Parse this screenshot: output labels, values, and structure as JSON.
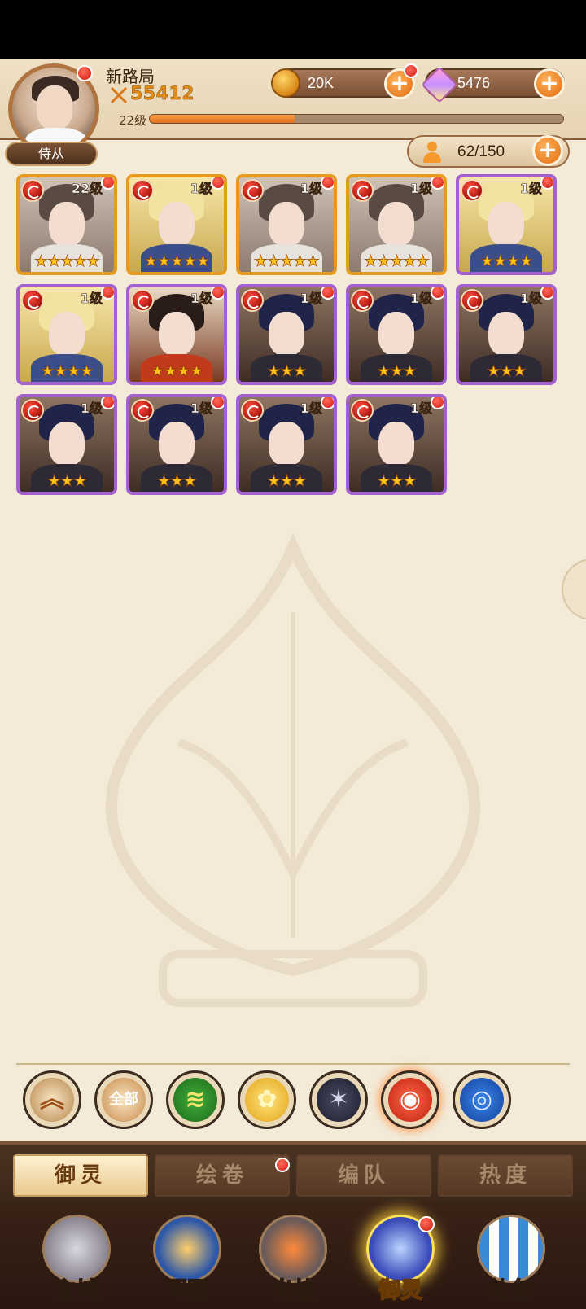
{
  "player": {
    "name": "新路局",
    "power": "55412",
    "level": "22级",
    "xp_fraction": 0.35
  },
  "resources": {
    "gold": "20K",
    "gems": "5476"
  },
  "attendant_tab": "侍从",
  "capacity": "62/150",
  "cards": [
    {
      "level": "22级",
      "frame": "gold",
      "stars": "★★★★★",
      "character": "crowned-lady"
    },
    {
      "level": "1级",
      "frame": "gold",
      "stars": "★★★★★",
      "character": "armored-knight"
    },
    {
      "level": "1级",
      "frame": "gold",
      "stars": "★★★★★",
      "character": "crowned-lady"
    },
    {
      "level": "1级",
      "frame": "gold",
      "stars": "★★★★★",
      "character": "crowned-lady"
    },
    {
      "level": "1级",
      "frame": "purple",
      "stars": "★★★★",
      "character": "armored-knight"
    },
    {
      "level": "1级",
      "frame": "purple",
      "stars": "★★★★",
      "character": "armored-knight"
    },
    {
      "level": "1级",
      "frame": "purple",
      "stars": "★★★★",
      "character": "warrior"
    },
    {
      "level": "1级",
      "frame": "purple",
      "stars": "★★★",
      "character": "glasses-man"
    },
    {
      "level": "1级",
      "frame": "purple",
      "stars": "★★★",
      "character": "glasses-man"
    },
    {
      "level": "1级",
      "frame": "purple",
      "stars": "★★★",
      "character": "glasses-man"
    },
    {
      "level": "1级",
      "frame": "purple",
      "stars": "★★★",
      "character": "glasses-man"
    },
    {
      "level": "1级",
      "frame": "purple",
      "stars": "★★★",
      "character": "glasses-man"
    },
    {
      "level": "1级",
      "frame": "purple",
      "stars": "★★★",
      "character": "glasses-man"
    },
    {
      "level": "1级",
      "frame": "purple",
      "stars": "★★★",
      "character": "glasses-man"
    }
  ],
  "filters": [
    {
      "name": "collapse",
      "label": "",
      "icon": "double-chevron-up-icon"
    },
    {
      "name": "all",
      "label": "全部",
      "icon": ""
    },
    {
      "name": "wind",
      "label": "",
      "icon": "wind-element-icon"
    },
    {
      "name": "light",
      "label": "",
      "icon": "flower-element-icon"
    },
    {
      "name": "dark",
      "label": "",
      "icon": "star-element-icon"
    },
    {
      "name": "fire",
      "label": "",
      "icon": "phoenix-element-icon"
    },
    {
      "name": "water",
      "label": "",
      "icon": "wave-element-icon"
    }
  ],
  "subtabs": [
    "御灵",
    "绘卷",
    "编队",
    "热度"
  ],
  "nav": [
    "主城",
    "军团",
    "出战",
    "御灵",
    "礼包"
  ],
  "colors": {
    "accent_orange": "#e2701f",
    "gold_frame": "#e69a1f",
    "purple_frame": "#a45fd0",
    "notification_red": "#d01b10"
  }
}
